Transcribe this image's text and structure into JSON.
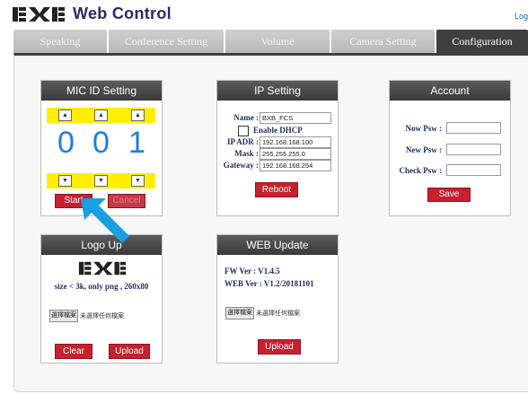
{
  "app": {
    "title": "Web Control",
    "logout": "Log"
  },
  "logo": {
    "text": "BXB"
  },
  "tabs": [
    {
      "label": "Speaking",
      "active": false
    },
    {
      "label": "Conference Setting",
      "active": false
    },
    {
      "label": "Volume",
      "active": false
    },
    {
      "label": "Camera Setting",
      "active": false
    },
    {
      "label": "Configuration Setting",
      "active": true
    }
  ],
  "mic_id": {
    "title": "MIC ID Setting",
    "digits": [
      "0",
      "0",
      "1"
    ],
    "start_label": "Start",
    "cancel_label": "Cancel"
  },
  "ip": {
    "title": "IP Setting",
    "name_label": "Name :",
    "name_value": "BXB_FCS",
    "dhcp_label": "Enable DHCP",
    "adr_label": "IP ADR :",
    "adr_value": "192.168.168.100",
    "mask_label": "Mask :",
    "mask_value": "255.255.255.0",
    "gateway_label": "Gateway :",
    "gateway_value": "192.168.168.254",
    "reboot_label": "Reboot"
  },
  "account": {
    "title": "Account",
    "now_label": "Now Psw :",
    "new_label": "New Psw :",
    "check_label": "Check Psw :",
    "save_label": "Save"
  },
  "logo_upload": {
    "title": "Logo Up",
    "hint": "size < 3k, only png , 260x80",
    "file_button": "選擇檔案",
    "file_status": "未選擇任何檔案",
    "clear_label": "Clear",
    "upload_label": "Upload"
  },
  "web_update": {
    "title": "WEB Update",
    "fw_ver": "FW Ver : V1.4.5",
    "web_ver": "WEB Ver : V1.2/20181101",
    "file_button": "選擇檔案",
    "file_status": "未選擇任何檔案",
    "upload_label": "Upload"
  },
  "colors": {
    "accent": "#c8202f",
    "digit": "#1e7de0",
    "highlight": "#ffee00",
    "tab_active": "#3f3f3f"
  }
}
